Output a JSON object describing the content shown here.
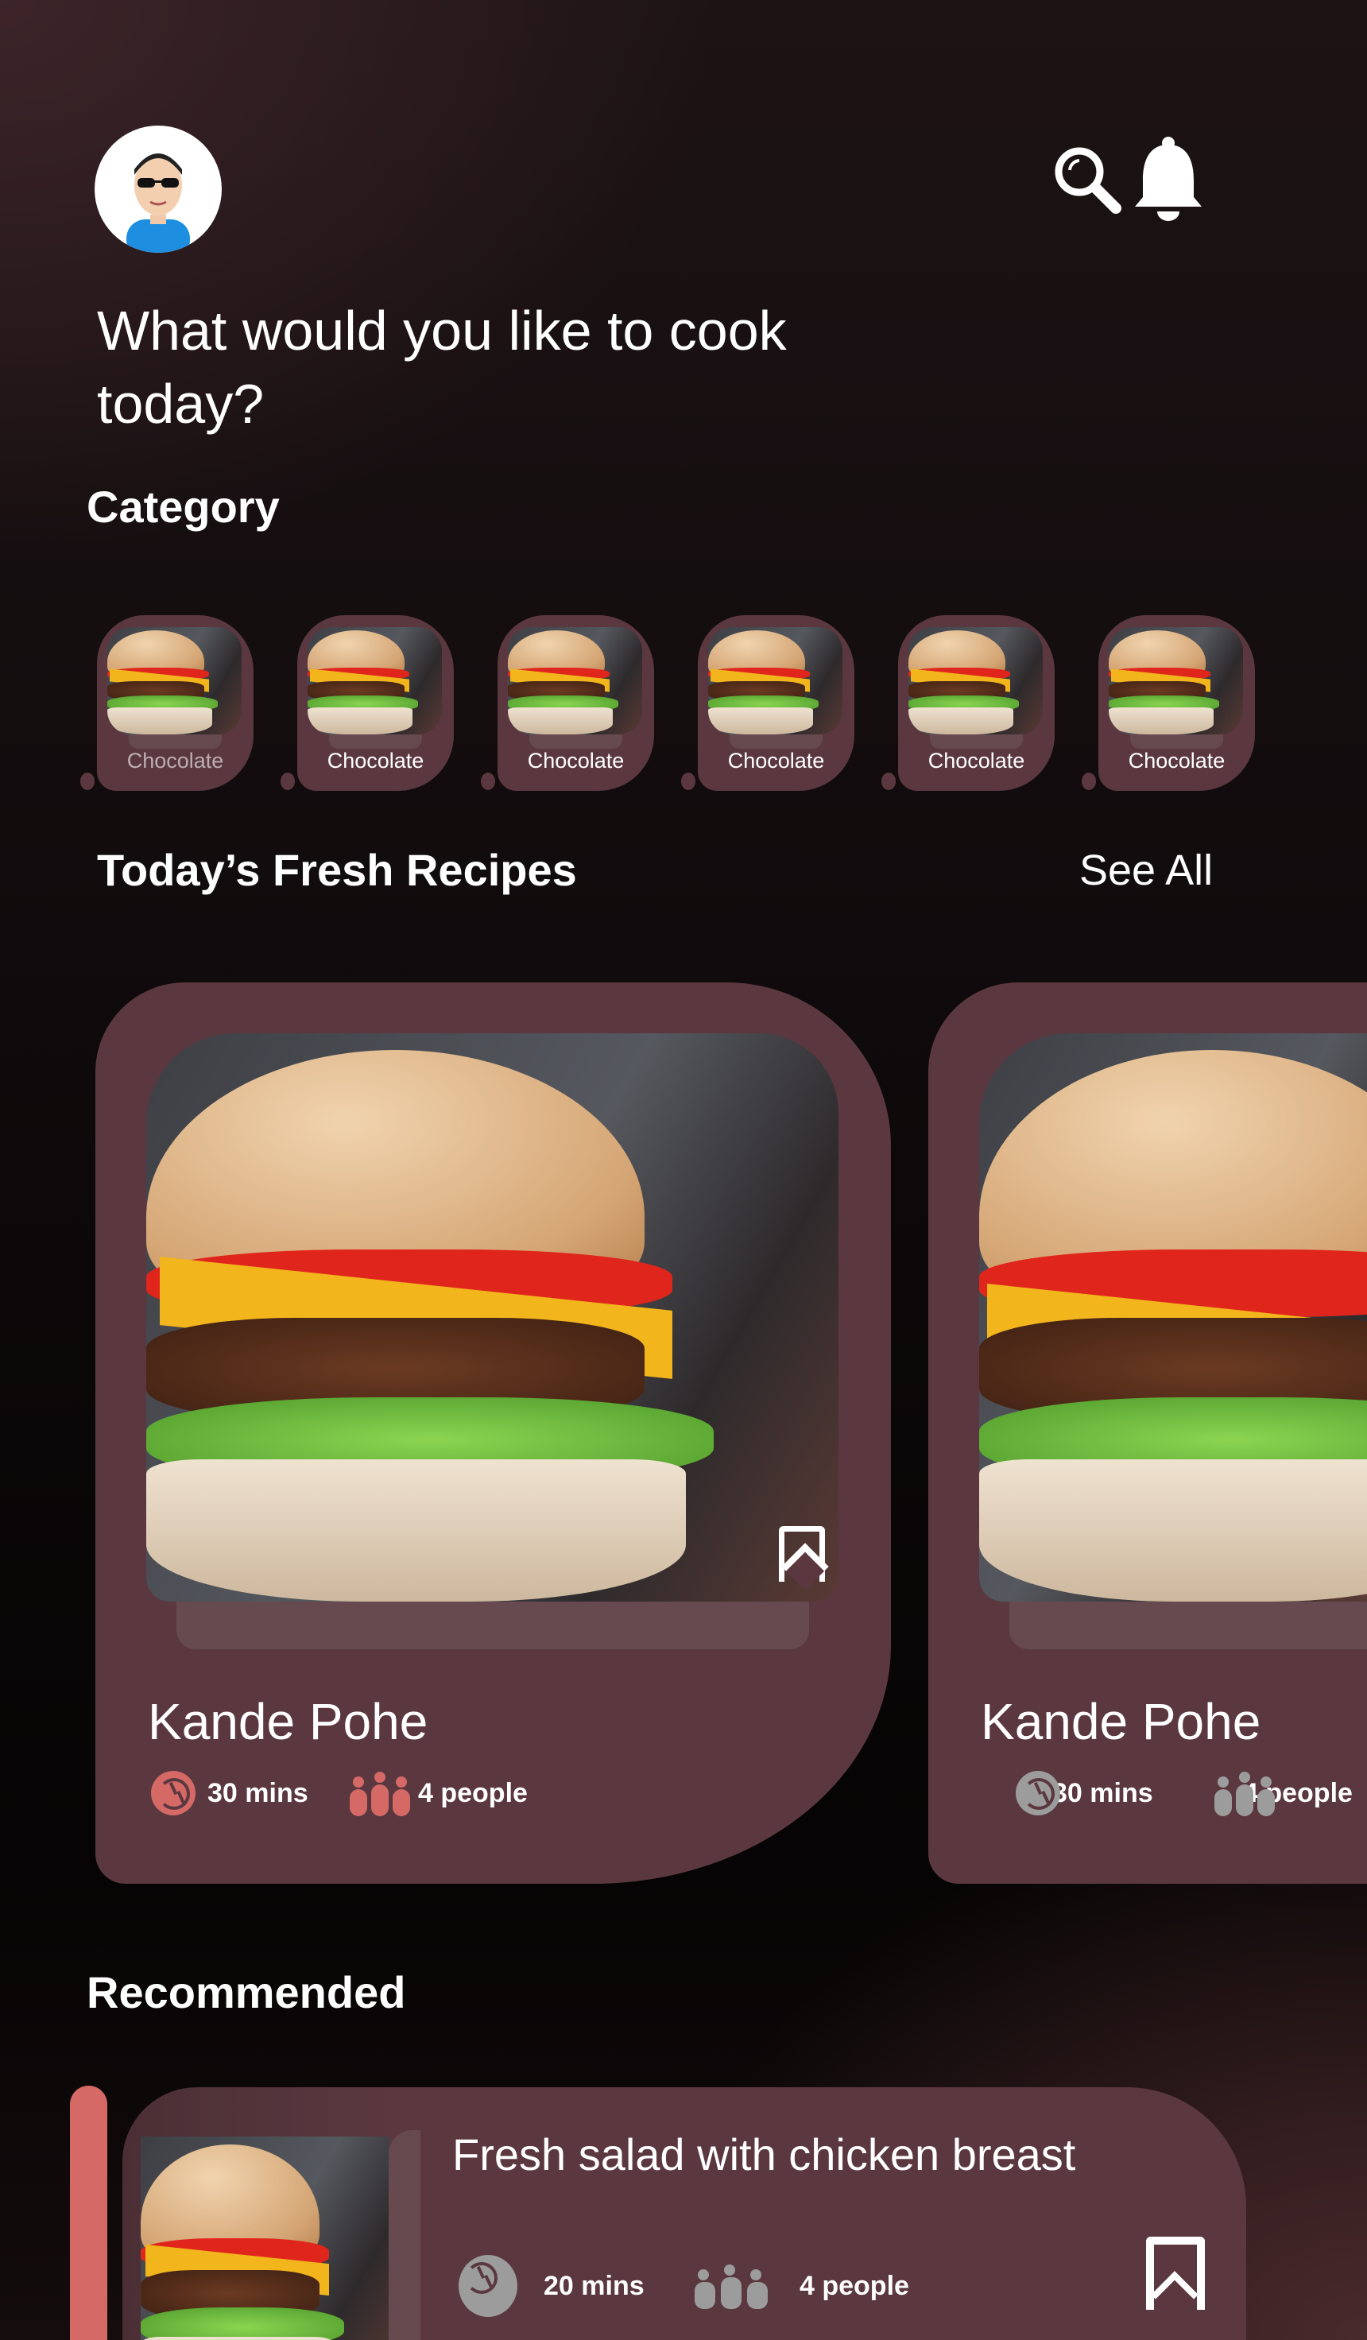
{
  "header": {
    "headline": "What would you like to cook today?",
    "avatar": "avatar-user",
    "icons": [
      "search-icon",
      "bell-icon"
    ]
  },
  "category": {
    "title": "Category",
    "items": [
      {
        "label": "Chocolate"
      },
      {
        "label": "Chocolate"
      },
      {
        "label": "Chocolate"
      },
      {
        "label": "Chocolate"
      },
      {
        "label": "Chocolate"
      },
      {
        "label": "Chocolate"
      }
    ]
  },
  "fresh": {
    "title": "Today’s Fresh Recipes",
    "see_all": "See All",
    "cards": [
      {
        "title": "Kande Pohe",
        "time": "30 mins",
        "people": "4 people"
      },
      {
        "title": "Kande Pohe",
        "time": "30 mins",
        "people": "4 people"
      }
    ]
  },
  "recommended": {
    "title": "Recommended",
    "items": [
      {
        "title": "Fresh salad with chicken breast",
        "time": "20 mins",
        "people": "4 people"
      }
    ]
  },
  "colors": {
    "card": "#5b3840",
    "accent": "#d56966",
    "muted": "#9c9c9c"
  }
}
